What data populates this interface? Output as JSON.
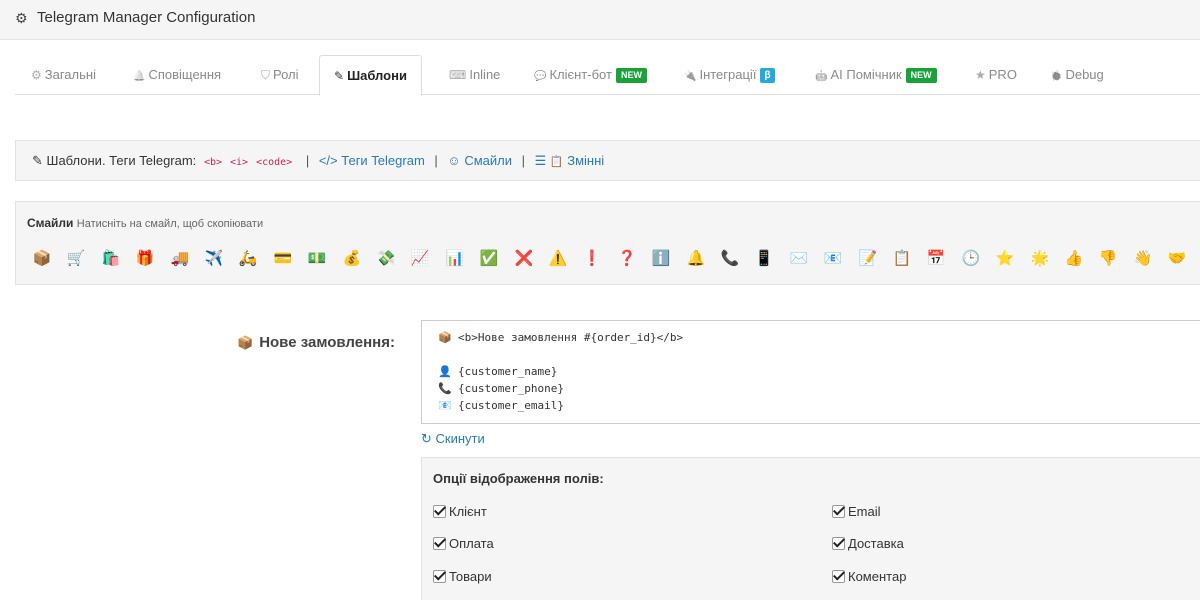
{
  "app": {
    "title": "Telegram Manager Configuration",
    "icon": "gear-icon"
  },
  "tabs": [
    {
      "label": "Загальні",
      "icon": "gear-icon",
      "glyph": "⚙",
      "active": false
    },
    {
      "label": "Сповіщення",
      "icon": "bell-icon",
      "glyph": "🔔",
      "active": false
    },
    {
      "label": "Ролі",
      "icon": "shield-icon",
      "glyph": "⛉",
      "active": false
    },
    {
      "label": "Шаблони",
      "icon": "edit-icon",
      "glyph": "✎",
      "active": true
    },
    {
      "label": "Inline",
      "icon": "keyboard-icon",
      "glyph": "⌨",
      "active": false
    },
    {
      "label": "Клієнт-бот",
      "icon": "chat-icon",
      "glyph": "💬",
      "active": false,
      "badge": "NEW"
    },
    {
      "label": "Інтеграції",
      "icon": "plug-icon",
      "glyph": "🔌",
      "active": false,
      "badge": "β"
    },
    {
      "label": "AI Помічник",
      "icon": "android-icon",
      "glyph": "🤖",
      "active": false,
      "badge": "NEW"
    },
    {
      "label": "PRO",
      "icon": "star-icon",
      "glyph": "★",
      "active": false
    },
    {
      "label": "Debug",
      "icon": "bug-icon",
      "glyph": "🐞",
      "active": false
    }
  ],
  "info": {
    "prefix": "Шаблони. Теги Telegram:",
    "tags": [
      "<b>",
      "<i>",
      "<code>"
    ],
    "separator": "|",
    "link_tags": "Теги Telegram",
    "link_emoji": "Смайли",
    "link_vars": "Змінні"
  },
  "emoji_panel": {
    "title": "Смайли",
    "hint": "Натисніть на смайл, щоб скопіювати",
    "items": [
      "📦",
      "🛒",
      "🛍️",
      "🎁",
      "🚚",
      "✈️",
      "🛵",
      "💳",
      "💵",
      "💰",
      "💸",
      "📈",
      "📊",
      "✅",
      "❌",
      "⚠️",
      "❗",
      "❓",
      "ℹ️",
      "🔔",
      "📞",
      "📱",
      "✉️",
      "📧",
      "📝",
      "📋",
      "📅",
      "🕒",
      "⭐",
      "🌟",
      "👍",
      "👎",
      "👋",
      "🤝"
    ]
  },
  "template": {
    "label": "Нове замовлення:",
    "label_icon": "📦",
    "lines": [
      {
        "icon": "📦",
        "text": "<b>Нове замовлення #{order_id}</b>"
      },
      {
        "icon": "",
        "text": ""
      },
      {
        "icon": "👤",
        "text": "{customer_name}"
      },
      {
        "icon": "📞",
        "text": "{customer_phone}"
      },
      {
        "icon": "📧",
        "text": "{customer_email}"
      }
    ],
    "reset_label": "Скинути"
  },
  "display_options": {
    "title": "Опції відображення полів:",
    "left": [
      {
        "label": "Клієнт",
        "checked": true
      },
      {
        "label": "Оплата",
        "checked": true
      },
      {
        "label": "Товари",
        "checked": true
      }
    ],
    "right": [
      {
        "label": "Email",
        "checked": true
      },
      {
        "label": "Доставка",
        "checked": true
      },
      {
        "label": "Коментар",
        "checked": true
      }
    ]
  }
}
